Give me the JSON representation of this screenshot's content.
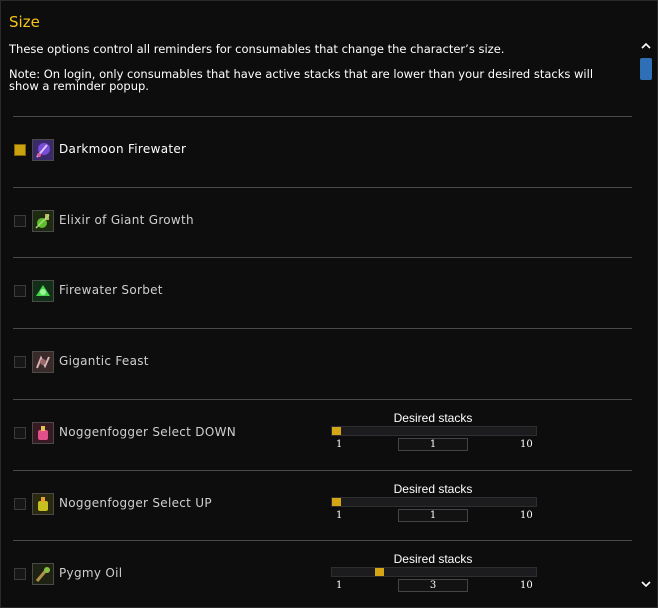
{
  "panel": {
    "title": "Size",
    "description": "These options control all reminders for consumables that change the character’s size.",
    "note": "Note: On login, only consumables that have active stacks that are lower than your desired stacks will show a reminder popup."
  },
  "items": [
    {
      "name": "Darkmoon Firewater",
      "checked": true,
      "icon": "firewater-bottle-icon",
      "has_slider": false
    },
    {
      "name": "Elixir of Giant Growth",
      "checked": false,
      "icon": "giant-growth-elixir-icon",
      "has_slider": false
    },
    {
      "name": "Firewater Sorbet",
      "checked": false,
      "icon": "sorbet-icon",
      "has_slider": false
    },
    {
      "name": "Gigantic Feast",
      "checked": false,
      "icon": "feast-icon",
      "has_slider": false
    },
    {
      "name": "Noggenfogger Select DOWN",
      "checked": false,
      "icon": "noggenfogger-down-icon",
      "has_slider": true,
      "slider": {
        "label": "Desired stacks",
        "min": "1",
        "max": "10",
        "value": "1",
        "fraction": 0.0
      }
    },
    {
      "name": "Noggenfogger Select UP",
      "checked": false,
      "icon": "noggenfogger-up-icon",
      "has_slider": true,
      "slider": {
        "label": "Desired stacks",
        "min": "1",
        "max": "10",
        "value": "1",
        "fraction": 0.0
      }
    },
    {
      "name": "Pygmy Oil",
      "checked": false,
      "icon": "pygmy-oil-icon",
      "has_slider": true,
      "slider": {
        "label": "Desired stacks",
        "min": "1",
        "max": "10",
        "value": "3",
        "fraction": 0.222
      }
    }
  ],
  "scrollbar": {
    "up_icon": "chevron-up-icon",
    "down_icon": "chevron-down-icon",
    "thumb_color": "#2e6fb5"
  },
  "colors": {
    "accent": "#f5c518",
    "checkbox_checked": "#c9a20e",
    "slider_thumb": "#d4a514"
  }
}
